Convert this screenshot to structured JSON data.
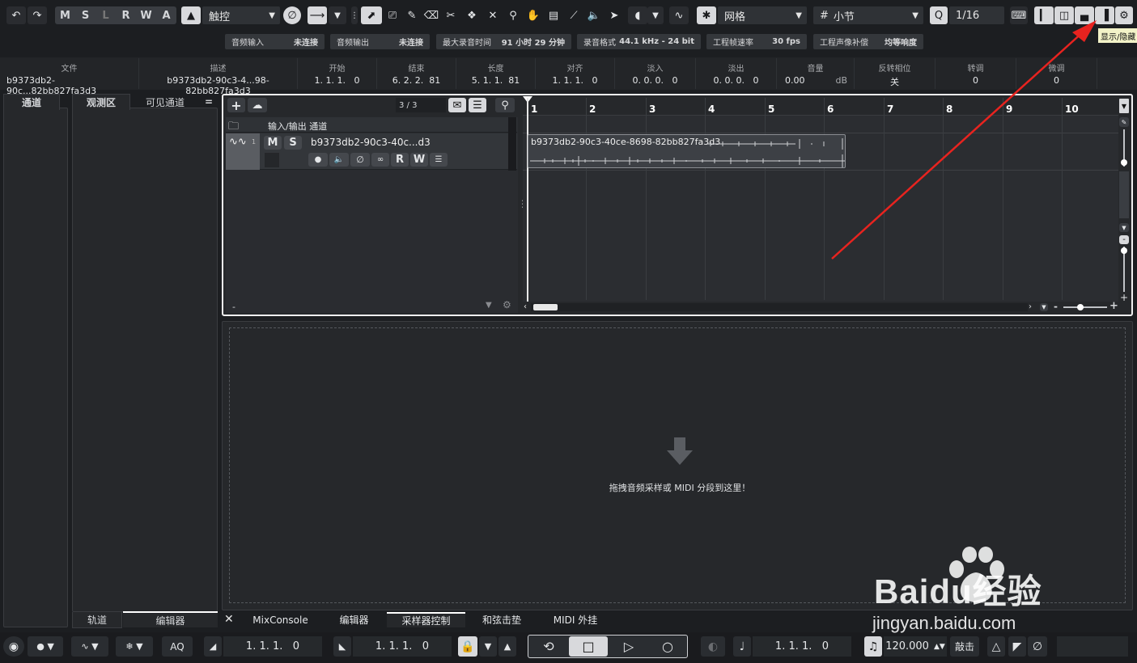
{
  "toolbar": {
    "msr": [
      "M",
      "S",
      "L",
      "R",
      "W",
      "A"
    ],
    "automation_mode": "触控",
    "snap_type": "网格",
    "grid_type": "小节",
    "quantize": "1/16"
  },
  "tooltip": "显示/隐藏",
  "status_bar": [
    {
      "label": "音频输入",
      "value": "未连接"
    },
    {
      "label": "音频输出",
      "value": "未连接"
    },
    {
      "label": "最大录音时间",
      "value": "91 小时 29 分钟"
    },
    {
      "label": "录音格式",
      "value": "44.1 kHz - 24 bit"
    },
    {
      "label": "工程帧速率",
      "value": "30 fps"
    },
    {
      "label": "工程声像补偿",
      "value": "均等响度"
    }
  ],
  "info_line": [
    {
      "label": "文件",
      "value": "b9373db2-90c...82bb827fa3d3"
    },
    {
      "label": "描述",
      "value": "b9373db2-90c3-4...98-82bb827fa3d3"
    },
    {
      "label": "开始",
      "value": "1. 1. 1.   0"
    },
    {
      "label": "结束",
      "value": "6. 2. 2.  81"
    },
    {
      "label": "长度",
      "value": "5. 1. 1.  81"
    },
    {
      "label": "对齐",
      "value": "1. 1. 1.   0"
    },
    {
      "label": "淡入",
      "value": "0. 0. 0.   0"
    },
    {
      "label": "淡出",
      "value": "0. 0. 0.   0"
    },
    {
      "label": "音量",
      "value": "0.00",
      "unit": "dB"
    },
    {
      "label": "反转相位",
      "value": "关"
    },
    {
      "label": "转调",
      "value": "0"
    },
    {
      "label": "微调",
      "value": "0"
    }
  ],
  "left_zone": {
    "tab_channel": "通道",
    "tab_inspector": "观测区",
    "tab_visible": "可见通道",
    "menu": "=",
    "bottom_tab_tracks": "轨道",
    "bottom_tab_editor": "编辑器"
  },
  "track_list": {
    "track_count": "3 / 3",
    "folder_label": "输入/输出 通道",
    "track_number": "1",
    "track_name": "b9373db2-90c3-40c...d3",
    "mute": "M",
    "solo": "S",
    "read": "R",
    "write": "W",
    "minus": "-"
  },
  "ruler": [
    "1",
    "2",
    "3",
    "4",
    "5",
    "6",
    "7",
    "8",
    "9",
    "10"
  ],
  "event": {
    "name": "b9373db2-90c3-40ce-8698-82bb827fa3d3"
  },
  "lower_zone": {
    "drop_hint": "拖拽音频采样或 MIDI 分段到这里！",
    "tabs": [
      "MixConsole",
      "编辑器",
      "采样器控制",
      "和弦击垫",
      "MIDI 外挂"
    ]
  },
  "transport": {
    "left_locator": "1. 1. 1.   0",
    "right_locator": "1. 1. 1.   0",
    "position": "1. 1. 1.   0",
    "tempo": "120.000",
    "tap": "敲击",
    "aq": "AQ"
  },
  "watermark": {
    "brand": "Baidu经验",
    "url": "jingyan.baidu.com"
  },
  "colors": {
    "background": "#1c1e21",
    "panel": "#26282b",
    "accent_white": "#ffffff",
    "arrow_red": "#e8231f",
    "selected_tab": "#ffffff"
  }
}
